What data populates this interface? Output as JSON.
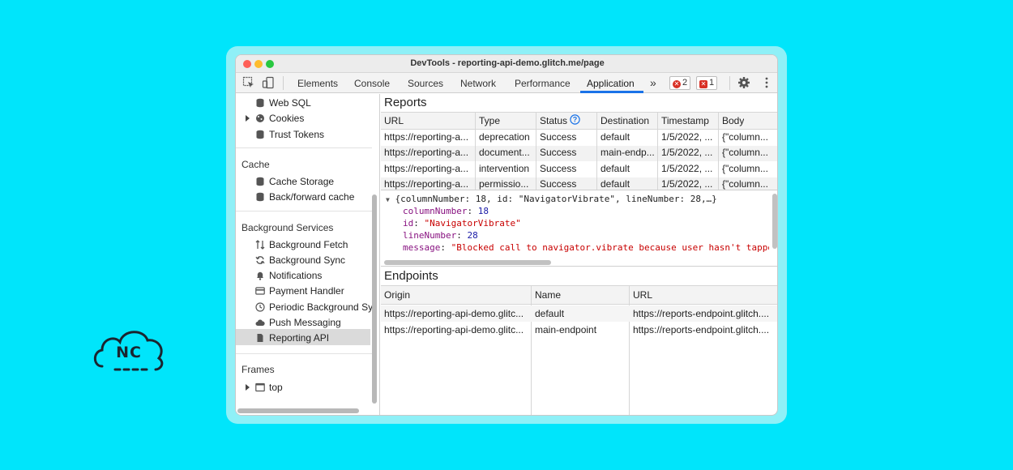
{
  "logo": {
    "text": "NC"
  },
  "window": {
    "title": "DevTools - reporting-api-demo.glitch.me/page"
  },
  "toolbar": {
    "tabs": [
      "Elements",
      "Console",
      "Sources",
      "Network",
      "Performance",
      "Application"
    ],
    "active_tab": "Application",
    "more": "»",
    "errors_count": "2",
    "issues_count": "1"
  },
  "sidebar": {
    "storage_items": [
      "Web SQL",
      "Cookies",
      "Trust Tokens"
    ],
    "cache_header": "Cache",
    "cache_items": [
      "Cache Storage",
      "Back/forward cache"
    ],
    "bg_header": "Background Services",
    "bg_items": [
      "Background Fetch",
      "Background Sync",
      "Notifications",
      "Payment Handler",
      "Periodic Background Sy",
      "Push Messaging",
      "Reporting API"
    ],
    "frames_header": "Frames",
    "frames_items": [
      "top"
    ]
  },
  "reports": {
    "title": "Reports",
    "columns": [
      "URL",
      "Type",
      "Status",
      "Destination",
      "Timestamp",
      "Body"
    ],
    "rows": [
      [
        "https://reporting-a...",
        "deprecation",
        "Success",
        "default",
        "1/5/2022, ...",
        "{\"column..."
      ],
      [
        "https://reporting-a...",
        "document...",
        "Success",
        "main-endp...",
        "1/5/2022, ...",
        "{\"column..."
      ],
      [
        "https://reporting-a...",
        "intervention",
        "Success",
        "default",
        "1/5/2022, ...",
        "{\"column..."
      ],
      [
        "https://reporting-a...",
        "permissio...",
        "Success",
        "default",
        "1/5/2022, ...",
        "{\"column..."
      ]
    ]
  },
  "json_preview": {
    "summary": "{columnNumber: 18, id: \"NavigatorVibrate\", lineNumber: 28,…}",
    "fields": [
      {
        "key": "columnNumber",
        "value": "18",
        "kind": "number"
      },
      {
        "key": "id",
        "value": "\"NavigatorVibrate\"",
        "kind": "string"
      },
      {
        "key": "lineNumber",
        "value": "28",
        "kind": "number"
      },
      {
        "key": "message",
        "value": "\"Blocked call to navigator.vibrate because user hasn't tapped",
        "kind": "string"
      }
    ]
  },
  "endpoints": {
    "title": "Endpoints",
    "columns": [
      "Origin",
      "Name",
      "URL"
    ],
    "rows": [
      [
        "https://reporting-api-demo.glitc...",
        "default",
        "https://reports-endpoint.glitch...."
      ],
      [
        "https://reporting-api-demo.glitc...",
        "main-endpoint",
        "https://reports-endpoint.glitch...."
      ]
    ]
  },
  "colors": {
    "background": "#00e5fb",
    "accent": "#1a73e8",
    "error": "#d93025"
  }
}
